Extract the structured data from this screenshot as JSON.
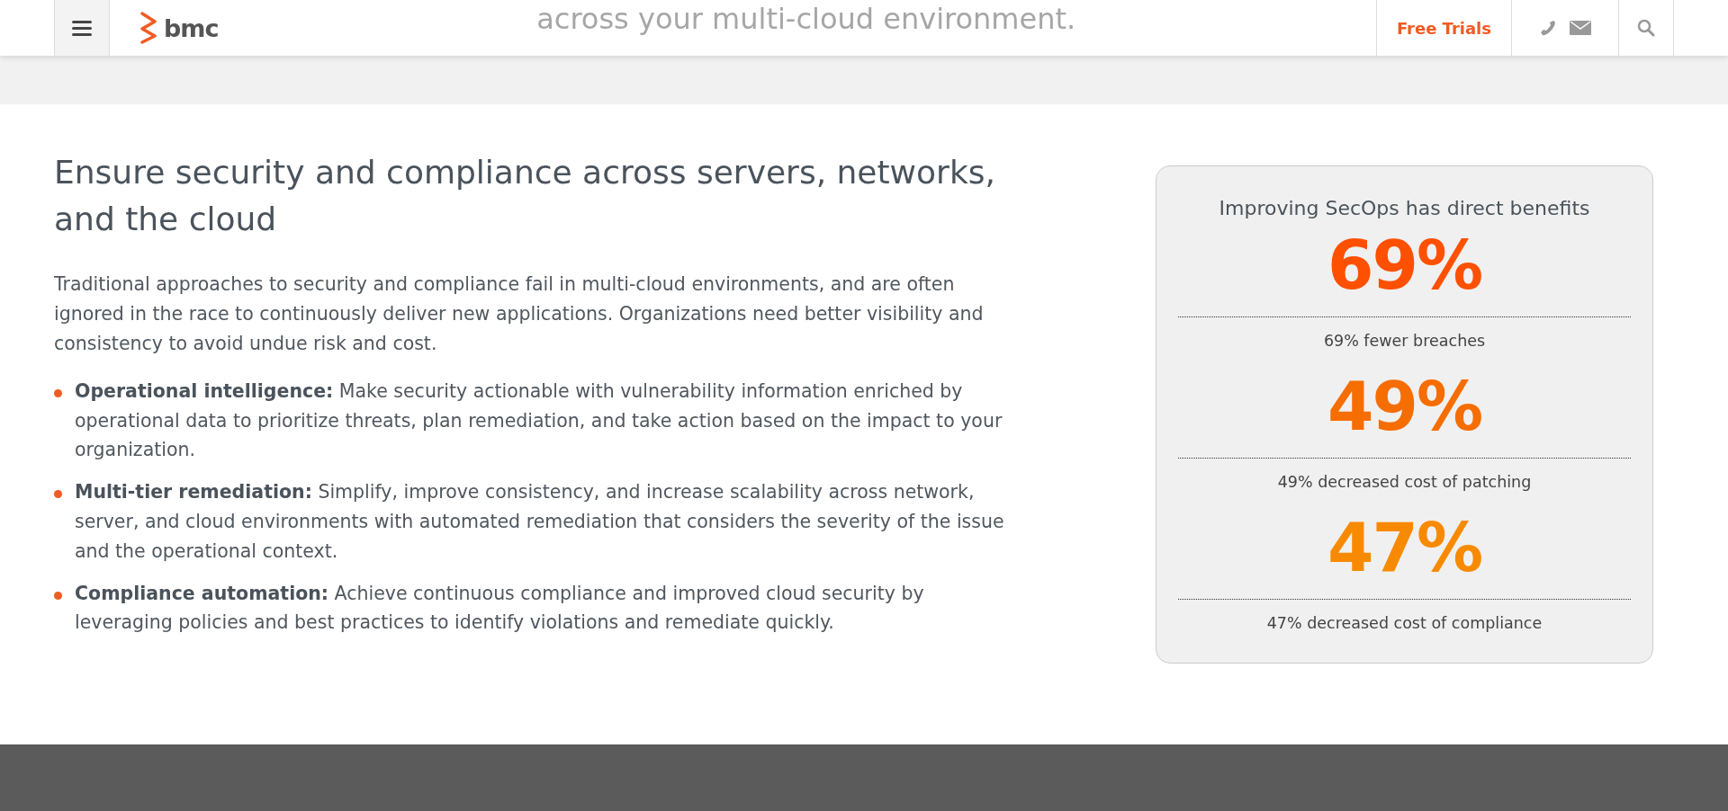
{
  "header": {
    "logo": "bmc",
    "faded_banner": "across your multi-cloud environment.",
    "free_trials": "Free Trials"
  },
  "section": {
    "heading": "Ensure security and compliance across servers, networks, and the cloud",
    "intro": "Traditional approaches to security and compliance fail in multi-cloud environments, and are often ignored in the race to continuously deliver new applications. Organizations need better visibility and consistency to avoid undue risk and cost.",
    "bullets": [
      {
        "text": "**Operational intelligence:** Make security actionable with vulnerability information enriched by operational data to prioritize threats, plan remediation, and take action based on the impact to your organization."
      },
      {
        "text": "**Multi-tier remediation:** Simplify, improve consistency, and increase scalability across network, server, and cloud environments with automated remediation that considers the severity of the issue and the operational context."
      },
      {
        "text": "**Compliance automation:** Achieve continuous compliance and improved cloud security by leveraging policies and best practices to identify violations and remediate quickly."
      }
    ]
  },
  "stats_card": {
    "title": "Improving SecOps has direct benefits",
    "stats": [
      {
        "value": "69%",
        "color": "#ff5000",
        "caption": "69% fewer breaches"
      },
      {
        "value": "49%",
        "color": "#f66d00",
        "caption": "49% decreased cost of patching"
      },
      {
        "value": "47%",
        "color": "#f88a00",
        "caption": "47% decreased cost of compliance"
      }
    ]
  }
}
